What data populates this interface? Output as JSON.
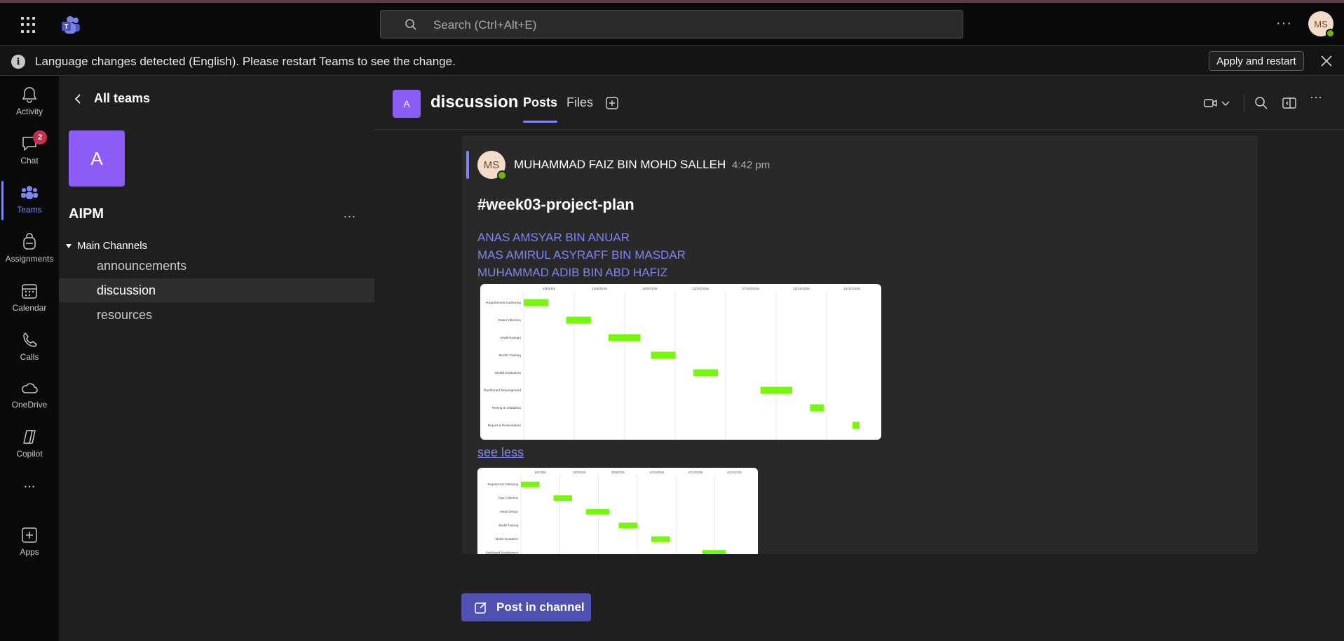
{
  "search": {
    "placeholder": "Search (Ctrl+Alt+E)"
  },
  "profile": {
    "initials": "MS"
  },
  "notification": {
    "message": "Language changes detected (English). Please restart Teams to see the change.",
    "button_label": "Apply and restart",
    "info_glyph": "i"
  },
  "rail": {
    "items": [
      {
        "label": "Activity",
        "icon": "bell-icon"
      },
      {
        "label": "Chat",
        "icon": "chat-icon",
        "badge": "2"
      },
      {
        "label": "Teams",
        "icon": "teams-icon"
      },
      {
        "label": "Assignments",
        "icon": "backpack-icon"
      },
      {
        "label": "Calendar",
        "icon": "calendar-icon"
      },
      {
        "label": "Calls",
        "icon": "phone-icon"
      },
      {
        "label": "OneDrive",
        "icon": "cloud-icon"
      },
      {
        "label": "Copilot",
        "icon": "copilot-icon"
      },
      {
        "label": "...",
        "icon": "more-icon"
      },
      {
        "label": "Apps",
        "icon": "apps-icon"
      }
    ]
  },
  "team_panel": {
    "back_label": "All teams",
    "team_initial": "A",
    "team_name": "AIPM",
    "more": "...",
    "section_label": "Main Channels",
    "channels": [
      "announcements",
      "discussion",
      "resources"
    ],
    "active_channel": "discussion"
  },
  "channel_header": {
    "initial": "A",
    "title": "discussion",
    "tabs": [
      "Posts",
      "Files"
    ],
    "active_tab": "Posts"
  },
  "post": {
    "author_initials": "MS",
    "author": "MUHAMMAD FAIZ BIN MOHD SALLEH",
    "time": "4:42 pm",
    "subject": "#week03-project-plan",
    "mentions": [
      "ANAS AMSYAR BIN ANUAR",
      "MAS AMIRUL ASYRAFF BIN MASDAR",
      "MUHAMMAD ADIB BIN ABD HAFIZ"
    ],
    "see_less": "see less"
  },
  "gantt_large": {
    "dates": [
      "1/9/2025",
      "15/9/2025",
      "29/9/2025",
      "13/10/2025",
      "27/10/2025",
      "10/11/2025",
      "24/11/2025"
    ],
    "tasks": [
      {
        "name": "Requirement Gathering",
        "start": 0.0,
        "end": 0.07
      },
      {
        "name": "Data Collection",
        "start": 0.12,
        "end": 0.19
      },
      {
        "name": "Model Design",
        "start": 0.24,
        "end": 0.33
      },
      {
        "name": "Model Training",
        "start": 0.36,
        "end": 0.43
      },
      {
        "name": "Model Evaluation",
        "start": 0.48,
        "end": 0.55
      },
      {
        "name": "Dashboard Development",
        "start": 0.67,
        "end": 0.76
      },
      {
        "name": "Testing & Validation",
        "start": 0.81,
        "end": 0.85
      },
      {
        "name": "Report & Presentation",
        "start": 0.93,
        "end": 0.95
      }
    ]
  },
  "gantt_small": {
    "dates": [
      "1/9/2025",
      "15/9/2025",
      "29/9/2025",
      "13/10/2025",
      "27/10/2025",
      "10/11/2025"
    ],
    "tasks": [
      {
        "name": "Requirement Gathering",
        "start": 0.0,
        "end": 0.08
      },
      {
        "name": "Data Collection",
        "start": 0.14,
        "end": 0.22
      },
      {
        "name": "Model Design",
        "start": 0.28,
        "end": 0.38
      },
      {
        "name": "Model Training",
        "start": 0.42,
        "end": 0.5
      },
      {
        "name": "Model Evaluation",
        "start": 0.56,
        "end": 0.64
      },
      {
        "name": "Dashboard Development",
        "start": 0.78,
        "end": 0.88
      }
    ]
  },
  "compose": {
    "label": "Post in channel"
  },
  "colors": {
    "accent": "#7f85f5",
    "button": "#4f52b2",
    "bar": "#76f80a",
    "team_tile": "#8b5cf6"
  }
}
